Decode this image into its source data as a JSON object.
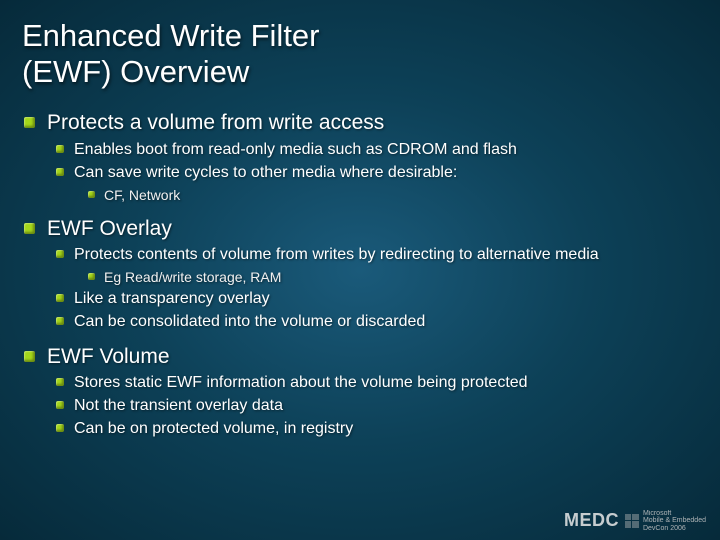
{
  "title": {
    "line1": "Enhanced Write Filter",
    "line2": "(EWF) Overview"
  },
  "sections": [
    {
      "heading": "Protects a volume from write access",
      "items": [
        {
          "text": "Enables boot from read-only media such as CDROM and flash"
        },
        {
          "text": "Can save write cycles to other media where desirable:",
          "sub": [
            "CF, Network"
          ]
        }
      ]
    },
    {
      "heading": "EWF Overlay",
      "items": [
        {
          "text": "Protects contents of volume from writes by redirecting to alternative media",
          "sub": [
            "Eg Read/write storage,  RAM"
          ]
        },
        {
          "text": "Like a transparency overlay"
        },
        {
          "text": "Can be consolidated into the volume or discarded"
        }
      ]
    },
    {
      "heading": "EWF Volume",
      "items": [
        {
          "text": "Stores static EWF information about the volume being protected"
        },
        {
          "text": "Not the transient overlay data"
        },
        {
          "text": "Can be on protected volume, in registry"
        }
      ]
    }
  ],
  "footer": {
    "brand": "MEDC",
    "sub1": "Microsoft",
    "sub2": "Mobile & Embedded",
    "sub3": "DevCon 2006"
  }
}
